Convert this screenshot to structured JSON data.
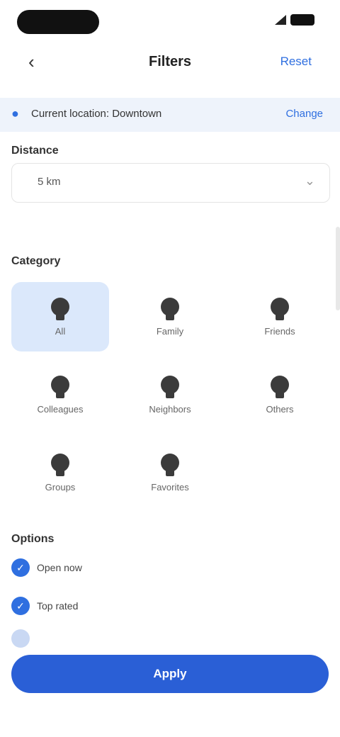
{
  "status_bar": {
    "time": "",
    "signal_icon": "signal-icon",
    "battery_icon": "battery-icon"
  },
  "nav": {
    "back_icon": "chevron-left-icon",
    "title": "Filters",
    "action": "Reset"
  },
  "location": {
    "icon": "location-pin-icon",
    "text": "Current location: Downtown",
    "action": "Change"
  },
  "section_distance": {
    "label": "Distance",
    "value": "5 km",
    "chevron": "chevron-down-icon"
  },
  "section_category": {
    "label": "Category",
    "tiles": [
      {
        "label": "All",
        "icon": "person-icon",
        "selected": true
      },
      {
        "label": "Family",
        "icon": "person-icon",
        "selected": false
      },
      {
        "label": "Friends",
        "icon": "person-icon",
        "selected": false
      },
      {
        "label": "Colleagues",
        "icon": "person-icon",
        "selected": false
      },
      {
        "label": "Neighbors",
        "icon": "person-icon",
        "selected": false
      },
      {
        "label": "Others",
        "icon": "person-icon",
        "selected": false
      },
      {
        "label": "Groups",
        "icon": "group-icon",
        "selected": false
      },
      {
        "label": "Favorites",
        "icon": "star-icon",
        "selected": false
      }
    ]
  },
  "section_options": {
    "label": "Options",
    "items": [
      {
        "label": "Open now",
        "checked": true
      },
      {
        "label": "Top rated",
        "checked": true
      },
      {
        "label": "",
        "checked": false
      }
    ]
  },
  "primary_button": {
    "label": "Apply"
  },
  "colors": {
    "accent": "#2a5fd6",
    "selected_tile": "#dbe8fb",
    "location_bar": "#eef3fb"
  }
}
